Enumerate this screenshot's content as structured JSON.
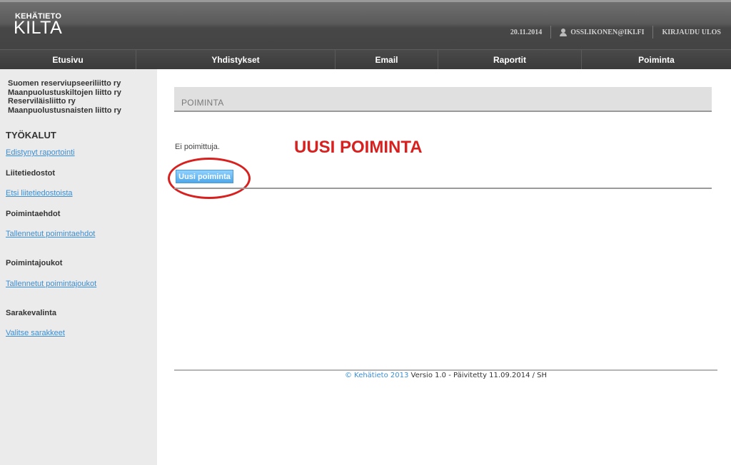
{
  "header": {
    "logo_small": "KEHÄTIETO",
    "logo_big": "KILTA",
    "date": "20.11.2014",
    "user": "OSSI.IKONEN@IKI.FI",
    "logout": "KIRJAUDU ULOS"
  },
  "nav": {
    "items": [
      {
        "label": "Etusivu"
      },
      {
        "label": "Yhdistykset"
      },
      {
        "label": "Email"
      },
      {
        "label": "Raportit"
      },
      {
        "label": "Poiminta"
      }
    ]
  },
  "sidebar": {
    "orgs": [
      "Suomen reserviupseeriliitto ry",
      "Maanpuolustuskiltojen liitto ry",
      "Reserviläisliitto ry",
      "Maanpuolustusnaisten liitto ry"
    ],
    "tools_heading": "TYÖKALUT",
    "tools_link": "Edistynyt raportointi",
    "attachments_heading": "Liitetiedostot",
    "attachments_link": "Etsi liitetiedostoista",
    "criteria_heading": "Poimintaehdot",
    "criteria_link": "Tallennetut poimintaehdot",
    "sets_heading": "Poimintajoukot",
    "sets_link": "Tallennetut poimintajoukot",
    "columns_heading": "Sarakevalinta",
    "columns_link": "Valitse sarakkeet"
  },
  "main": {
    "title": "POIMINTA",
    "empty_text": "Ei poimittuja.",
    "annotation": "UUSI POIMINTA",
    "new_button": "Uusi poiminta"
  },
  "footer": {
    "brand": "© Kehätieto 2013",
    "text": " Versio 1.0 - Päivitetty 11.09.2014 / SH"
  },
  "colors": {
    "link": "#3a8fd6",
    "annotation": "#d8201f",
    "button": "#5fb2f0"
  }
}
